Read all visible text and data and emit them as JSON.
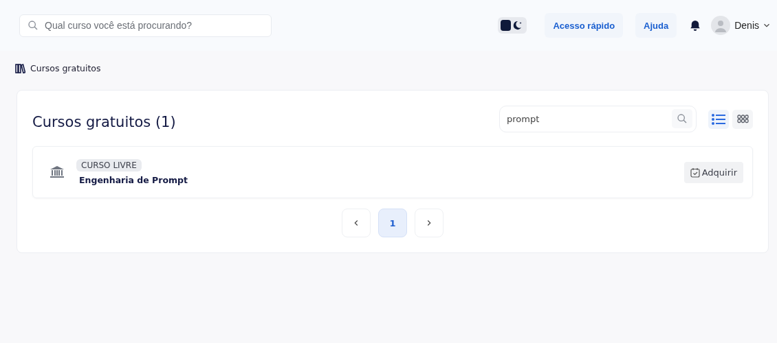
{
  "header": {
    "search": {
      "placeholder": "Qual curso você está procurando?"
    },
    "theme_toggle": {
      "on": false
    },
    "links": [
      {
        "label": "Acesso rápido"
      },
      {
        "label": "Ajuda"
      }
    ],
    "user": {
      "name": "Denis"
    }
  },
  "breadcrumb": {
    "label": "Cursos gratuitos"
  },
  "panel": {
    "title": "Cursos gratuitos (1)",
    "search": {
      "value": "prompt"
    },
    "views": [
      {
        "kind": "list",
        "selected": true
      },
      {
        "kind": "grid",
        "selected": false
      }
    ],
    "courses": [
      {
        "tag": "CURSO LIVRE",
        "name": "Engenharia de Prompt",
        "action": "Adquirir"
      }
    ],
    "pages": [
      {
        "label": "1",
        "selected": true
      }
    ]
  }
}
